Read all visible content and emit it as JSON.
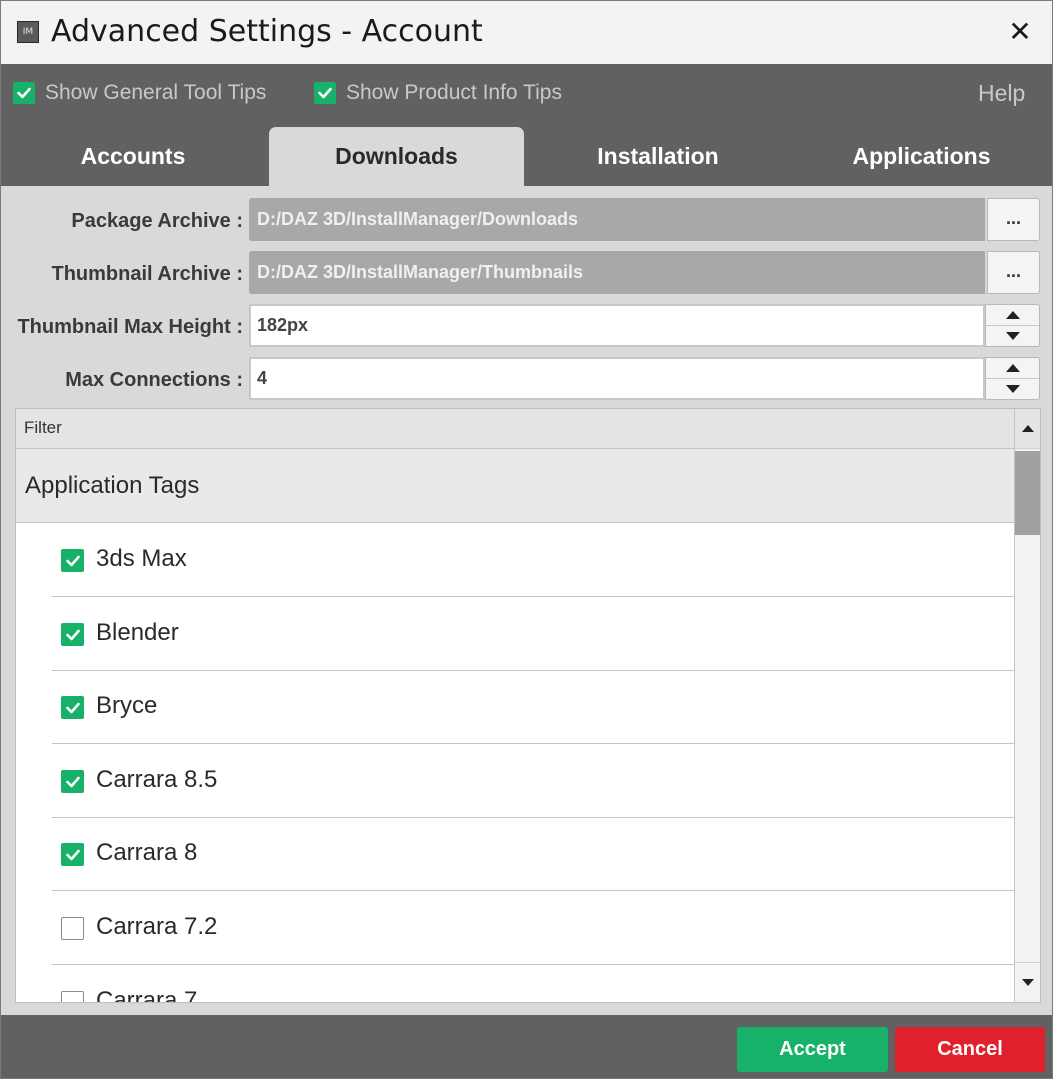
{
  "window": {
    "title": "Advanced Settings - Account",
    "app_icon_text": "IM",
    "close_glyph": "✕"
  },
  "tips": {
    "general": {
      "label": "Show General Tool Tips",
      "checked": true
    },
    "product": {
      "label": "Show Product Info Tips",
      "checked": true
    },
    "help_label": "Help"
  },
  "tabs": [
    {
      "label": "Accounts",
      "active": false
    },
    {
      "label": "Downloads",
      "active": true
    },
    {
      "label": "Installation",
      "active": false
    },
    {
      "label": "Applications",
      "active": false
    }
  ],
  "settings": {
    "package_archive": {
      "label": "Package Archive :",
      "value": "D:/DAZ 3D/InstallManager/Downloads",
      "button": "..."
    },
    "thumbnail_archive": {
      "label": "Thumbnail Archive :",
      "value": "D:/DAZ 3D/InstallManager/Thumbnails",
      "button": "..."
    },
    "thumbnail_max_height": {
      "label": "Thumbnail Max Height :",
      "value": "182px"
    },
    "max_connections": {
      "label": "Max Connections :",
      "value": "4"
    }
  },
  "list": {
    "filter_label": "Filter",
    "group_title": "Application Tags",
    "items": [
      {
        "label": "3ds Max",
        "checked": true
      },
      {
        "label": "Blender",
        "checked": true
      },
      {
        "label": "Bryce",
        "checked": true
      },
      {
        "label": "Carrara 8.5",
        "checked": true
      },
      {
        "label": "Carrara 8",
        "checked": true
      },
      {
        "label": "Carrara 7.2",
        "checked": false
      },
      {
        "label": "Carrara 7",
        "checked": false
      }
    ]
  },
  "footer": {
    "accept_label": "Accept",
    "cancel_label": "Cancel"
  },
  "colors": {
    "accent_green": "#17b169",
    "cancel_red": "#e0202c",
    "chrome_gray": "#616161",
    "panel_gray": "#d9d9d9"
  }
}
